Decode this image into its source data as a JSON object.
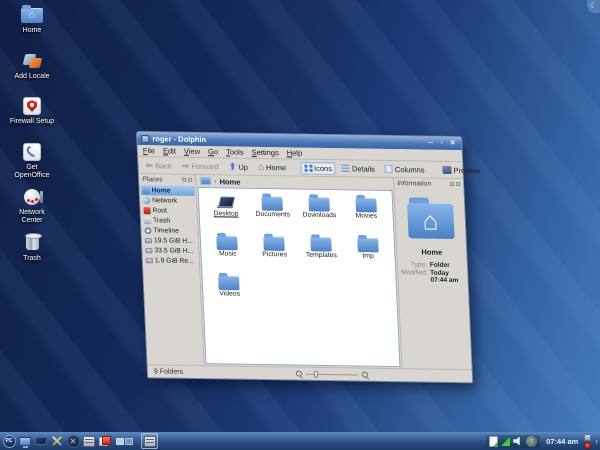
{
  "colors": {
    "titlebar": "#4a79b5",
    "selection": "#6da3dc",
    "folder_blue": "#4d83c6",
    "desktop_dark": "#0f1f46",
    "desktop_light": "#3a74b4",
    "taskbar": "#2c5085"
  },
  "desktop": {
    "icons": [
      {
        "label": "Home",
        "icon": "home-folder-icon"
      },
      {
        "label": "Add Locale",
        "icon": "locale-icon"
      },
      {
        "label": "Firewall Setup",
        "icon": "firewall-shield-icon"
      },
      {
        "label": "Get OpenOffice",
        "icon": "openoffice-icon"
      },
      {
        "label": "Network Center",
        "icon": "network-globe-icon"
      },
      {
        "label": "Trash",
        "icon": "trash-icon"
      }
    ]
  },
  "window": {
    "title": "roger - Dolphin",
    "controls": {
      "minimize": "─",
      "maximize": "▫",
      "close": "✕"
    },
    "menubar": {
      "items": [
        "File",
        "Edit",
        "View",
        "Go",
        "Tools",
        "Settings",
        "Help"
      ]
    },
    "toolbar": {
      "back": "Back",
      "forward": "Forward",
      "up": "Up",
      "home": "Home",
      "icons": "Icons",
      "details": "Details",
      "columns": "Columns",
      "preview": "Preview",
      "overflow": "»"
    },
    "places": {
      "header": "Places",
      "items": [
        {
          "label": "Home"
        },
        {
          "label": "Network"
        },
        {
          "label": "Root"
        },
        {
          "label": "Trash"
        },
        {
          "label": "Timeline"
        },
        {
          "label": "19.5 GiB H..."
        },
        {
          "label": "33.5 GiB H..."
        },
        {
          "label": "1.9 GiB Re..."
        }
      ]
    },
    "breadcrumb": {
      "separator": "›",
      "current": "Home"
    },
    "files": {
      "items": [
        {
          "name": "Desktop"
        },
        {
          "name": "Documents"
        },
        {
          "name": "Downloads"
        },
        {
          "name": "Movies"
        },
        {
          "name": "Music"
        },
        {
          "name": "Pictures"
        },
        {
          "name": "Templates"
        },
        {
          "name": "tmp"
        },
        {
          "name": "Videos"
        }
      ]
    },
    "information": {
      "header": "Information",
      "item_name": "Home",
      "type_label": "Type:",
      "type_value": "Folder",
      "modified_label": "Modified:",
      "modified_value": "Today 07:44 am"
    },
    "statusbar": {
      "summary": "9 Folders"
    }
  },
  "taskbar": {
    "pc_logo": "PC",
    "clock": "07:44 am",
    "update_arrow": "↑",
    "expander": "›",
    "config_glyph": "✕"
  }
}
